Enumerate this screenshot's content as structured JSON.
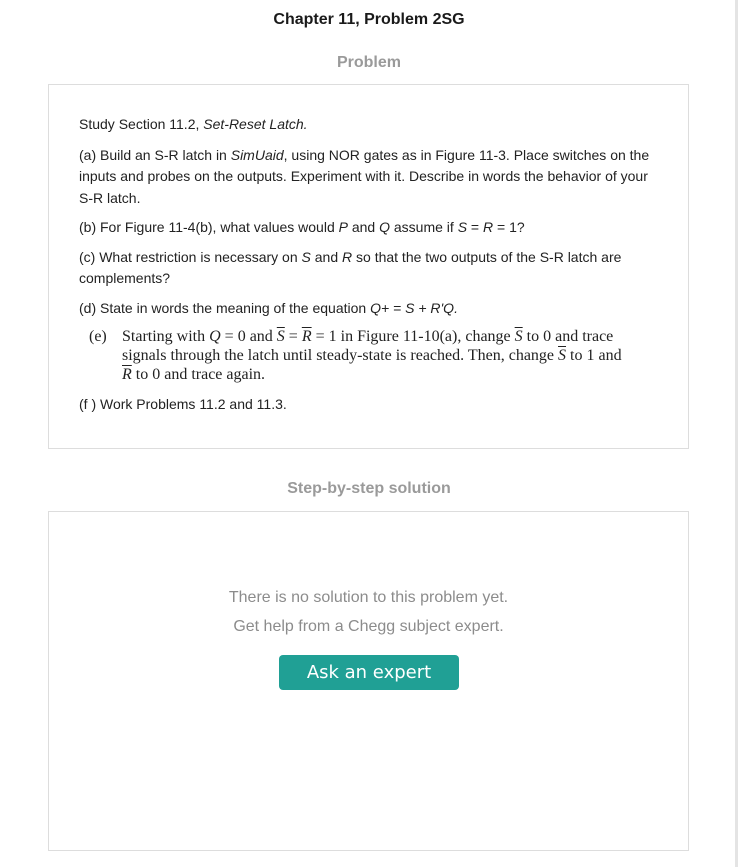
{
  "header": {
    "chapter_title": "Chapter 11, Problem 2SG"
  },
  "problem": {
    "heading": "Problem",
    "intro_prefix": "Study Section 11.2, ",
    "intro_topic": "Set-Reset Latch.",
    "part_a_1": "(a) Build an S-R latch in ",
    "part_a_tool": "SimUaid",
    "part_a_2": ", using NOR gates as in Figure 11-3. Place switches on the inputs and probes on the outputs. Experiment with it. Describe in words the behavior of your S-R latch.",
    "part_b_1": "(b) For Figure 11-4(b), what values would ",
    "part_b_p": "P",
    "part_b_2": " and ",
    "part_b_q": "Q",
    "part_b_3": " assume if ",
    "part_b_s": "S",
    "part_b_4": " = ",
    "part_b_r": "R",
    "part_b_5": " = 1?",
    "part_c_1": "(c) What restriction is necessary on ",
    "part_c_s": "S",
    "part_c_2": " and ",
    "part_c_r": "R",
    "part_c_3": " so that the two outputs of the S-R latch are complements?",
    "part_d_1": "(d) State in words the meaning of the equation ",
    "part_d_eq": "Q+ = S + R'Q.",
    "part_e": {
      "label": "(e)",
      "t1": "Starting with ",
      "q": "Q",
      "t2": " = 0 and ",
      "s_bar": "S",
      "t3": " = ",
      "r_bar": "R",
      "t4": " = 1 in Figure 11-10(a), change ",
      "s_bar2": "S",
      "t5": " to 0 and trace signals through the latch until steady-state is reached. Then, change ",
      "s_bar3": "S",
      "t6": " to 1 and ",
      "r_bar2": "R",
      "t7": " to 0 and trace again."
    },
    "part_f": "(f ) Work Problems 11.2 and 11.3."
  },
  "solution": {
    "heading": "Step-by-step solution",
    "empty_line_1": "There is no solution to this problem yet.",
    "empty_line_2": "Get help from a Chegg subject expert.",
    "ask_button_label": "Ask an expert"
  },
  "colors": {
    "accent": "#20a095",
    "heading_gray": "#9a9a9a",
    "border": "#dddddd"
  }
}
